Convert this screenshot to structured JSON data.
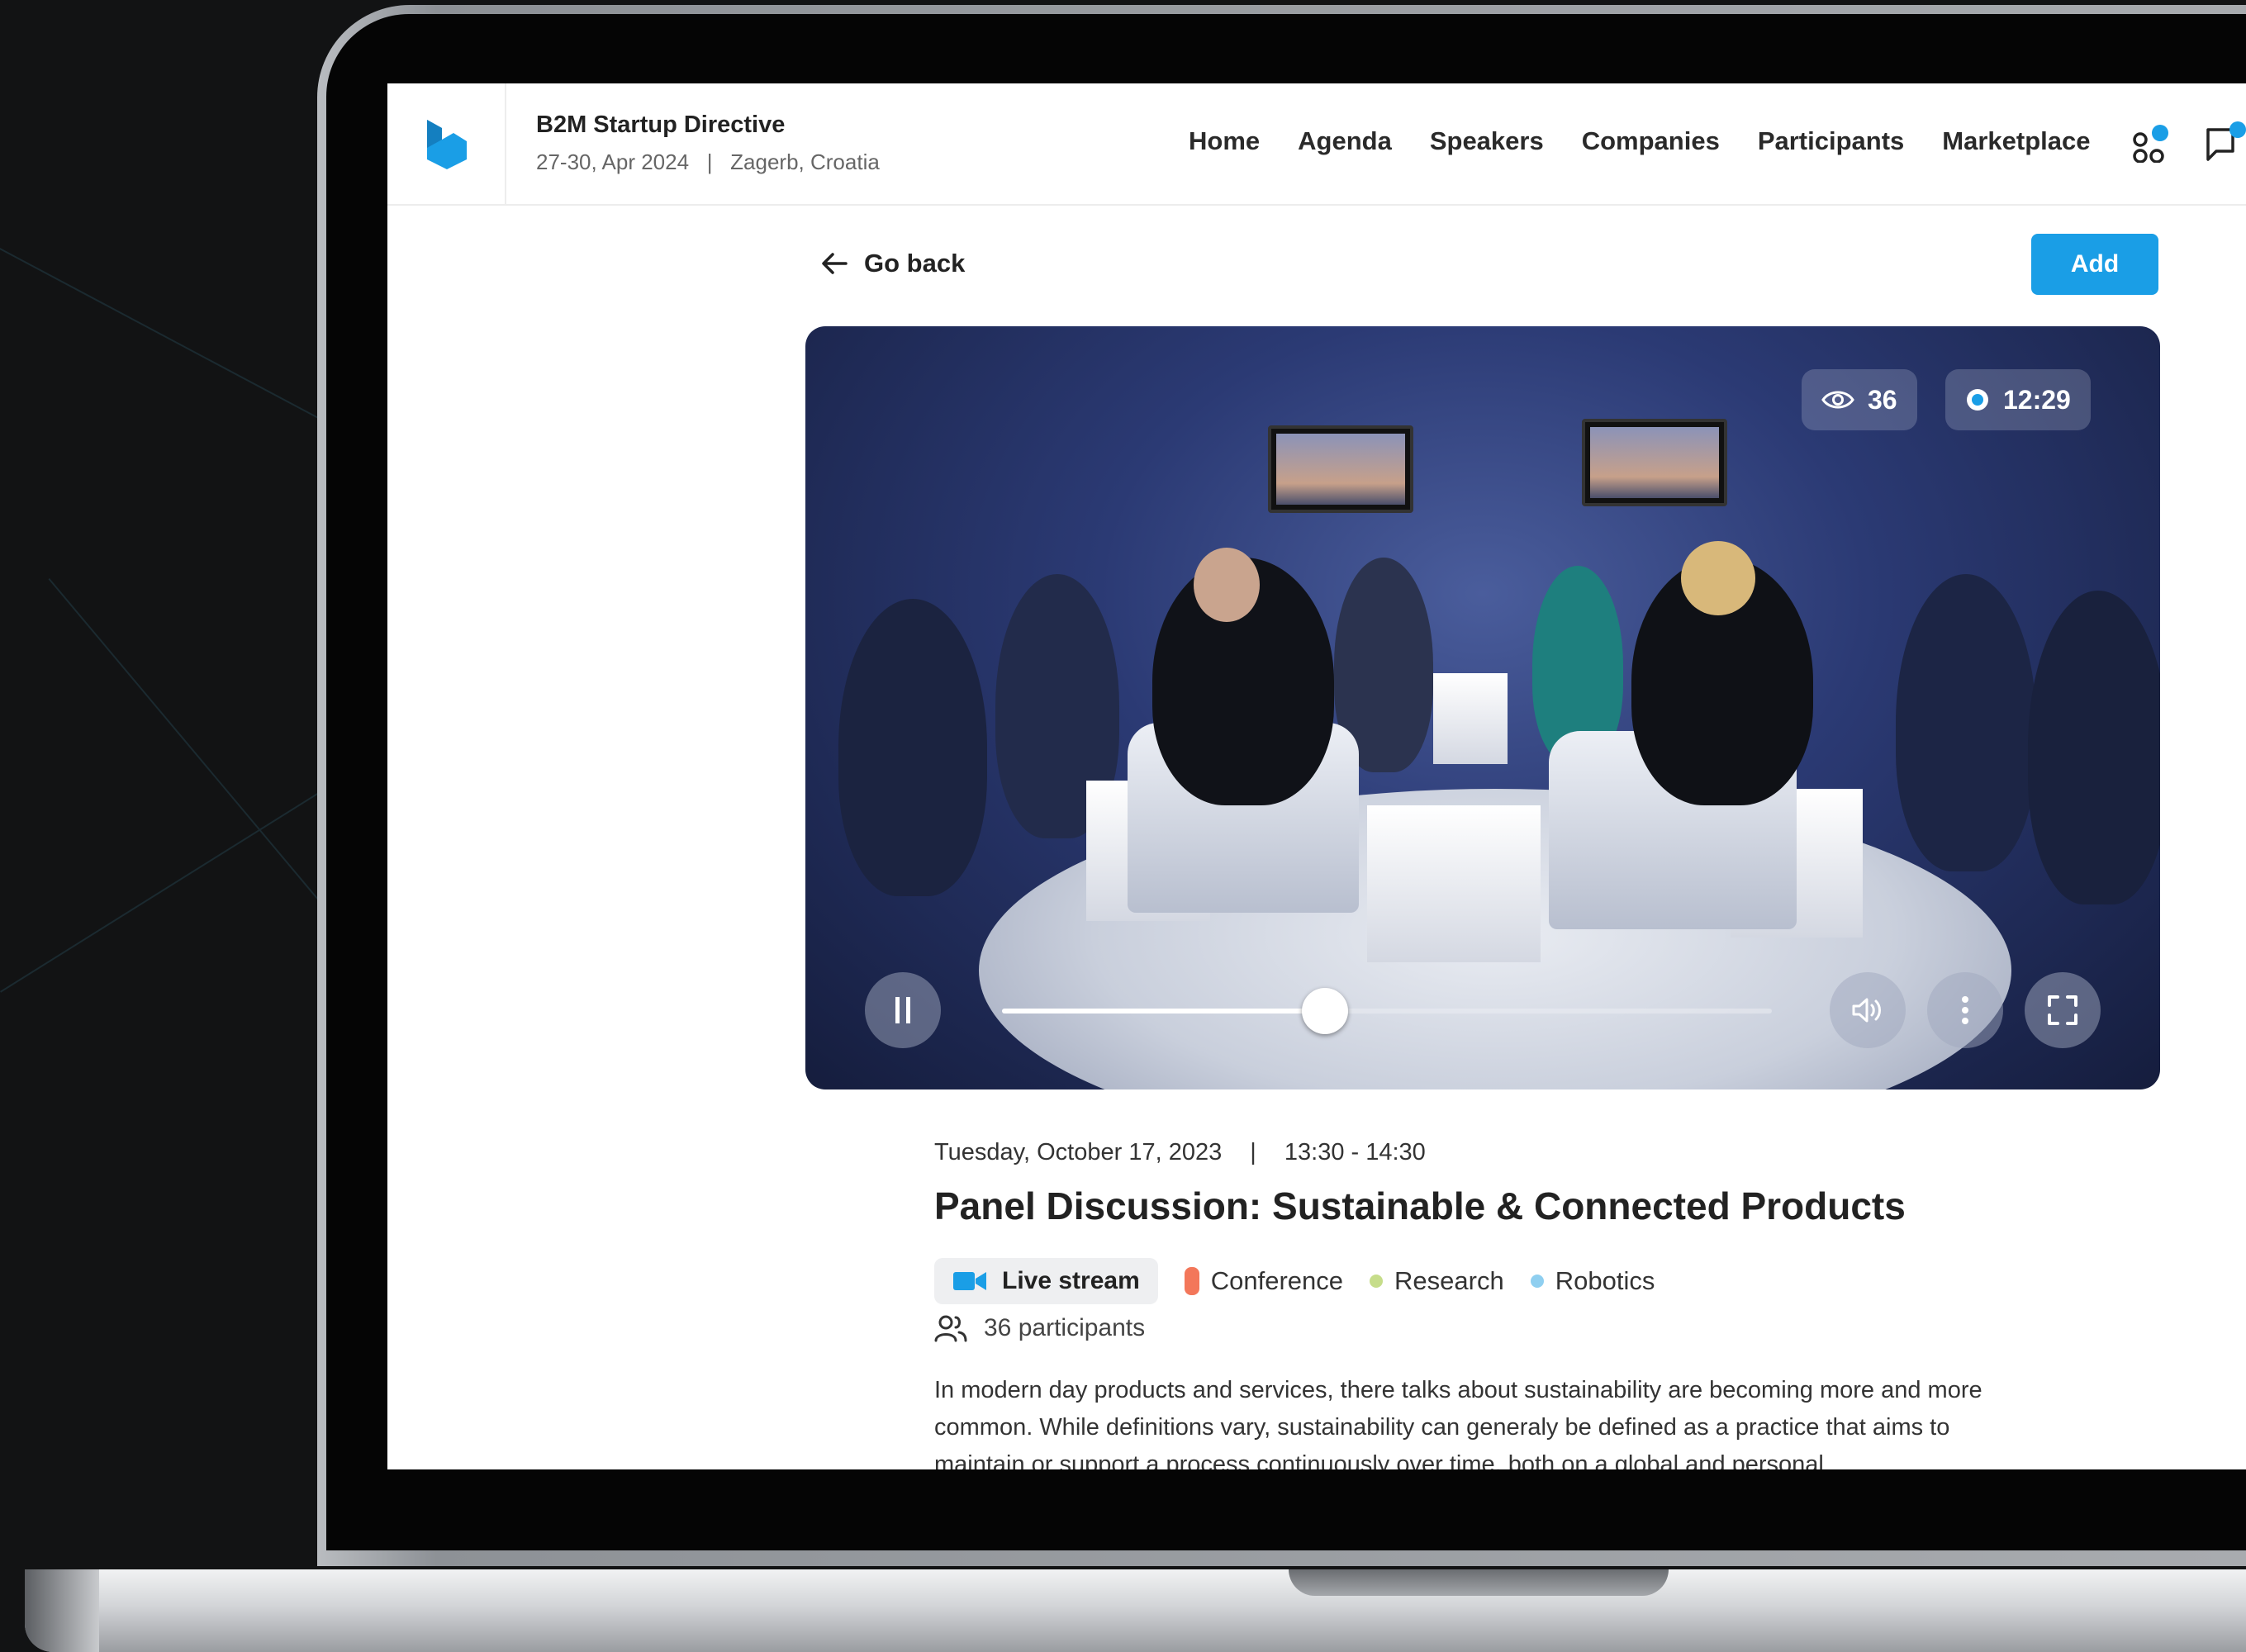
{
  "app": {
    "event_name": "B2M Startup Directive",
    "event_dates": "27-30, Apr 2024",
    "event_location": "Zagerb, Croatia"
  },
  "nav": {
    "items": [
      "Home",
      "Agenda",
      "Speakers",
      "Companies",
      "Participants",
      "Marketplace"
    ],
    "icons": [
      "apps-icon",
      "chat-icon"
    ]
  },
  "toolbar": {
    "back_label": "Go back",
    "add_label": "Add"
  },
  "player": {
    "viewers": "36",
    "live_time": "12:29",
    "progress": 0.42,
    "state": "playing"
  },
  "event": {
    "date": "Tuesday, October 17, 2023",
    "separator": "|",
    "time": "13:30 - 14:30",
    "title": "Panel Discussion: Sustainable & Connected Products",
    "live_tag": "Live stream",
    "tags": [
      {
        "label": "Conference",
        "color": "#f3775a"
      },
      {
        "label": "Research",
        "color": "#c6dd8a"
      },
      {
        "label": "Robotics",
        "color": "#8fcff0"
      }
    ],
    "participants": "36 participants",
    "description": "In modern day products and services, there talks about sustainability are becoming more and more common. While definitions vary, sustainability can generaly be defined as a practice that aims to maintain or support a process continuously over time, both on a global and personal"
  },
  "colors": {
    "accent": "#1a9ee6",
    "badge_dot": "#1a9ee6"
  }
}
